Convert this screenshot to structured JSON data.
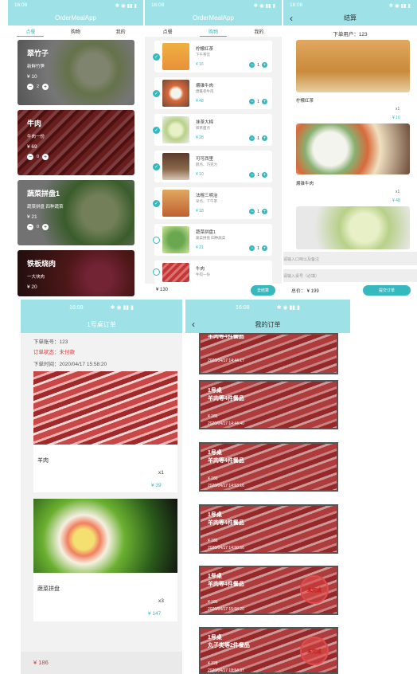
{
  "p1": {
    "time": "16:08",
    "app_title": "OrderMealApp",
    "tabs": [
      "点餐",
      "购物",
      "我的"
    ],
    "items": [
      {
        "name": "翠竹子",
        "desc": "新鲜竹笋",
        "price": "¥ 10",
        "qty": "2"
      },
      {
        "name": "牛肉",
        "desc": "牛肉一份",
        "price": "¥ 69",
        "qty": "0"
      },
      {
        "name": "蔬菜拼盘1",
        "desc": "蔬菜拼盘 四种蔬菜",
        "price": "¥ 21",
        "qty": "0"
      },
      {
        "name": "铁板烧肉",
        "desc": "一大块肉",
        "price": "¥ 20",
        "qty": ""
      }
    ]
  },
  "p2": {
    "time": "16:08",
    "app_title": "OrderMealApp",
    "tabs": [
      "点餐",
      "购物",
      "我的"
    ],
    "items": [
      {
        "name": "柠檬红茶",
        "desc": "下午茶饮",
        "price": "¥ 16",
        "qty": "1",
        "checked": true
      },
      {
        "name": "煨锥牛肉",
        "desc": "煨锥卷牛肉",
        "price": "¥ 48",
        "qty": "1",
        "checked": true
      },
      {
        "name": "抹茶大棉",
        "desc": "抹茶甜点",
        "price": "¥ 28",
        "qty": "1",
        "checked": true
      },
      {
        "name": "可可西里",
        "desc": "糕点、巧克力",
        "price": "¥ 10",
        "qty": "1",
        "checked": true
      },
      {
        "name": "法棍三明治",
        "desc": "早点、下午茶",
        "price": "¥ 18",
        "qty": "1",
        "checked": true
      },
      {
        "name": "蔬菜拼盘1",
        "desc": "蔬菜拼盘 四种蔬菜",
        "price": "¥ 21",
        "qty": "1",
        "checked": false
      },
      {
        "name": "牛肉",
        "desc": "牛肉一份",
        "price": "",
        "qty": "",
        "checked": false
      }
    ],
    "total": "¥ 130",
    "checkout": "去结算"
  },
  "p3": {
    "time": "16:08",
    "title": "结算",
    "user": "下单用户：123",
    "items": [
      {
        "name": "柠檬红茶",
        "qty": "x1",
        "price": "¥ 16"
      },
      {
        "name": "煨锥牛肉",
        "qty": "x1",
        "price": "¥ 48"
      }
    ],
    "remark_placeholder": "请输入口味以及备注",
    "table_placeholder": "请输入桌号（必填）",
    "total": "总价：  ¥ 199",
    "submit": "提交订单"
  },
  "p4": {
    "time": "16:09",
    "title": "1号桌订单",
    "account": "下单账号：123",
    "status": "订单状态：未付款",
    "ordertime": "下单时间：2020/04/17 15:58:20",
    "items": [
      {
        "name": "羊肉",
        "qty": "x1",
        "price": "¥ 39"
      },
      {
        "name": "蔬菜拼盘",
        "qty": "x3",
        "price": "¥ 147"
      }
    ],
    "total": "¥ 186"
  },
  "p5": {
    "time": "16:08",
    "title": "我的订单",
    "stamp": "未完成",
    "orders": [
      {
        "table": "",
        "summary": "羊肉等4件餐品",
        "price": "",
        "time": "2020/04/17 14:44:17",
        "stamp": false
      },
      {
        "table": "1号桌",
        "summary": "羊肉等4件餐品",
        "price": "¥ 186",
        "time": "2020/04/17 14:44:40",
        "stamp": false
      },
      {
        "table": "1号桌",
        "summary": "羊肉等4件餐品",
        "price": "¥ 186",
        "time": "2020/04/17 14:53:16",
        "stamp": false
      },
      {
        "table": "1号桌",
        "summary": "羊肉等4件餐品",
        "price": "¥ 186",
        "time": "2020/04/17 14:50:56",
        "stamp": false
      },
      {
        "table": "1号桌",
        "summary": "羊肉等4件餐品",
        "price": "¥ 186",
        "time": "2020/04/17 15:58:20",
        "stamp": true
      },
      {
        "table": "1号桌",
        "summary": "丸子类等2件餐品",
        "price": "¥ 328",
        "time": "2020/04/17 18:54:37",
        "stamp": true
      }
    ]
  }
}
